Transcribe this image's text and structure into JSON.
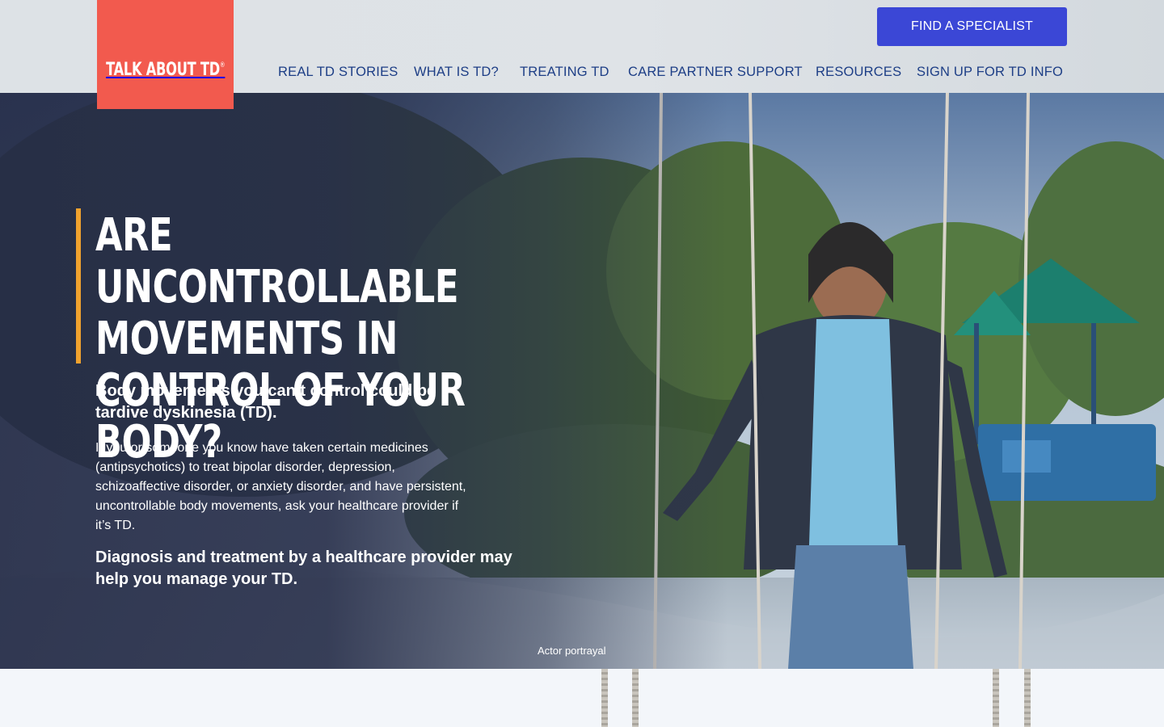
{
  "header": {
    "logo_text": "TALK ABOUT TD",
    "logo_mark": "®",
    "cta_label": "FIND A SPECIALIST",
    "nav": [
      {
        "label": "REAL TD STORIES"
      },
      {
        "label": "WHAT IS TD?"
      },
      {
        "label": "TREATING TD"
      },
      {
        "label": "CARE PARTNER SUPPORT"
      },
      {
        "label": "RESOURCES"
      },
      {
        "label": "SIGN UP FOR TD INFO"
      }
    ]
  },
  "hero": {
    "headline": "ARE UNCONTROLLABLE MOVEMENTS IN CONTROL OF YOUR BODY?",
    "subhead": "Body movements you can’t control could be tardive dyskinesia (TD).",
    "body": "If you or someone you know have taken certain medicines (antipsychotics) to treat bipolar disorder, depression, schizoaffective disorder, or anxiety disorder, and have persistent, uncontrollable body movements, ask your healthcare provider if it’s TD.",
    "closing": "Diagnosis and treatment by a healthcare provider may help you manage your TD.",
    "caption": "Actor portrayal"
  },
  "colors": {
    "logo_bg": "#f25a4e",
    "cta_bg": "#3b47d6",
    "nav_text": "#1d3e86",
    "accent_bar": "#f0a22e"
  }
}
